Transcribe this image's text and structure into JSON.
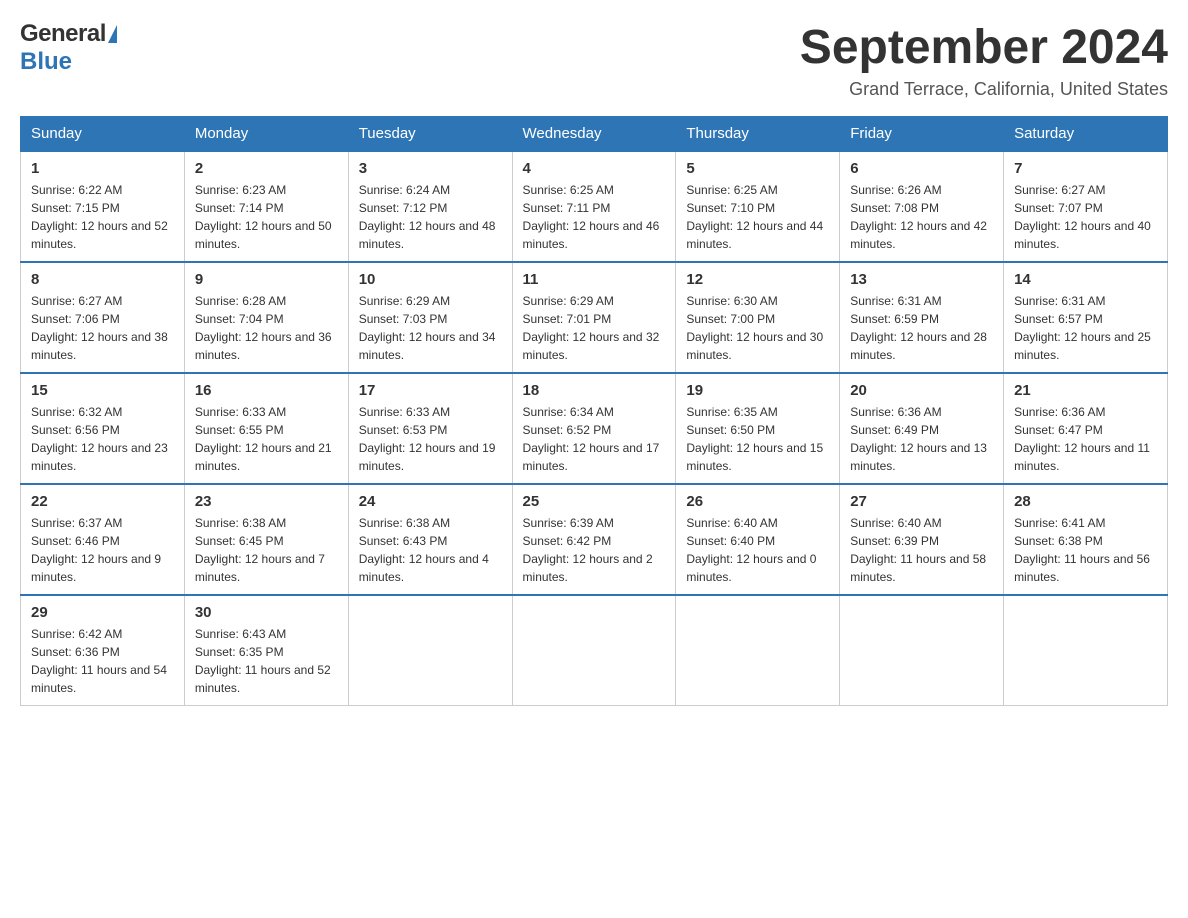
{
  "header": {
    "logo_general": "General",
    "logo_blue": "Blue",
    "month_title": "September 2024",
    "location": "Grand Terrace, California, United States"
  },
  "calendar": {
    "days_of_week": [
      "Sunday",
      "Monday",
      "Tuesday",
      "Wednesday",
      "Thursday",
      "Friday",
      "Saturday"
    ],
    "weeks": [
      [
        {
          "day": "1",
          "sunrise": "6:22 AM",
          "sunset": "7:15 PM",
          "daylight": "12 hours and 52 minutes."
        },
        {
          "day": "2",
          "sunrise": "6:23 AM",
          "sunset": "7:14 PM",
          "daylight": "12 hours and 50 minutes."
        },
        {
          "day": "3",
          "sunrise": "6:24 AM",
          "sunset": "7:12 PM",
          "daylight": "12 hours and 48 minutes."
        },
        {
          "day": "4",
          "sunrise": "6:25 AM",
          "sunset": "7:11 PM",
          "daylight": "12 hours and 46 minutes."
        },
        {
          "day": "5",
          "sunrise": "6:25 AM",
          "sunset": "7:10 PM",
          "daylight": "12 hours and 44 minutes."
        },
        {
          "day": "6",
          "sunrise": "6:26 AM",
          "sunset": "7:08 PM",
          "daylight": "12 hours and 42 minutes."
        },
        {
          "day": "7",
          "sunrise": "6:27 AM",
          "sunset": "7:07 PM",
          "daylight": "12 hours and 40 minutes."
        }
      ],
      [
        {
          "day": "8",
          "sunrise": "6:27 AM",
          "sunset": "7:06 PM",
          "daylight": "12 hours and 38 minutes."
        },
        {
          "day": "9",
          "sunrise": "6:28 AM",
          "sunset": "7:04 PM",
          "daylight": "12 hours and 36 minutes."
        },
        {
          "day": "10",
          "sunrise": "6:29 AM",
          "sunset": "7:03 PM",
          "daylight": "12 hours and 34 minutes."
        },
        {
          "day": "11",
          "sunrise": "6:29 AM",
          "sunset": "7:01 PM",
          "daylight": "12 hours and 32 minutes."
        },
        {
          "day": "12",
          "sunrise": "6:30 AM",
          "sunset": "7:00 PM",
          "daylight": "12 hours and 30 minutes."
        },
        {
          "day": "13",
          "sunrise": "6:31 AM",
          "sunset": "6:59 PM",
          "daylight": "12 hours and 28 minutes."
        },
        {
          "day": "14",
          "sunrise": "6:31 AM",
          "sunset": "6:57 PM",
          "daylight": "12 hours and 25 minutes."
        }
      ],
      [
        {
          "day": "15",
          "sunrise": "6:32 AM",
          "sunset": "6:56 PM",
          "daylight": "12 hours and 23 minutes."
        },
        {
          "day": "16",
          "sunrise": "6:33 AM",
          "sunset": "6:55 PM",
          "daylight": "12 hours and 21 minutes."
        },
        {
          "day": "17",
          "sunrise": "6:33 AM",
          "sunset": "6:53 PM",
          "daylight": "12 hours and 19 minutes."
        },
        {
          "day": "18",
          "sunrise": "6:34 AM",
          "sunset": "6:52 PM",
          "daylight": "12 hours and 17 minutes."
        },
        {
          "day": "19",
          "sunrise": "6:35 AM",
          "sunset": "6:50 PM",
          "daylight": "12 hours and 15 minutes."
        },
        {
          "day": "20",
          "sunrise": "6:36 AM",
          "sunset": "6:49 PM",
          "daylight": "12 hours and 13 minutes."
        },
        {
          "day": "21",
          "sunrise": "6:36 AM",
          "sunset": "6:47 PM",
          "daylight": "12 hours and 11 minutes."
        }
      ],
      [
        {
          "day": "22",
          "sunrise": "6:37 AM",
          "sunset": "6:46 PM",
          "daylight": "12 hours and 9 minutes."
        },
        {
          "day": "23",
          "sunrise": "6:38 AM",
          "sunset": "6:45 PM",
          "daylight": "12 hours and 7 minutes."
        },
        {
          "day": "24",
          "sunrise": "6:38 AM",
          "sunset": "6:43 PM",
          "daylight": "12 hours and 4 minutes."
        },
        {
          "day": "25",
          "sunrise": "6:39 AM",
          "sunset": "6:42 PM",
          "daylight": "12 hours and 2 minutes."
        },
        {
          "day": "26",
          "sunrise": "6:40 AM",
          "sunset": "6:40 PM",
          "daylight": "12 hours and 0 minutes."
        },
        {
          "day": "27",
          "sunrise": "6:40 AM",
          "sunset": "6:39 PM",
          "daylight": "11 hours and 58 minutes."
        },
        {
          "day": "28",
          "sunrise": "6:41 AM",
          "sunset": "6:38 PM",
          "daylight": "11 hours and 56 minutes."
        }
      ],
      [
        {
          "day": "29",
          "sunrise": "6:42 AM",
          "sunset": "6:36 PM",
          "daylight": "11 hours and 54 minutes."
        },
        {
          "day": "30",
          "sunrise": "6:43 AM",
          "sunset": "6:35 PM",
          "daylight": "11 hours and 52 minutes."
        },
        null,
        null,
        null,
        null,
        null
      ]
    ]
  }
}
